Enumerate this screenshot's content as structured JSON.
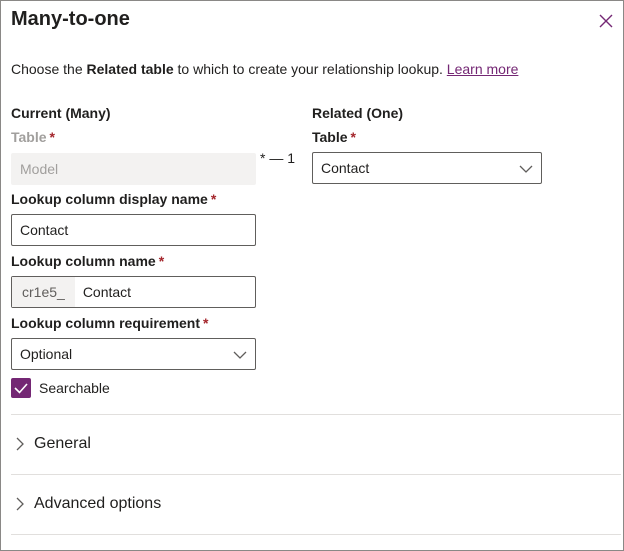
{
  "panel": {
    "title": "Many-to-one",
    "close_icon": "close-icon",
    "intro_prefix": "Choose the ",
    "intro_bold": "Related table",
    "intro_suffix": " to which to create your relationship lookup. ",
    "learn_more": "Learn more"
  },
  "current": {
    "heading": "Current (Many)",
    "table_label": "Table",
    "table_value": "Model",
    "lookup_display_label": "Lookup column display name",
    "lookup_display_value": "Contact",
    "lookup_name_label": "Lookup column name",
    "lookup_name_prefix": "cr1e5_",
    "lookup_name_value": "Contact",
    "requirement_label": "Lookup column requirement",
    "requirement_value": "Optional",
    "searchable_label": "Searchable",
    "searchable_checked": true
  },
  "cardinality": {
    "many": "*",
    "dash": "—",
    "one": "1"
  },
  "related": {
    "heading": "Related (One)",
    "table_label": "Table",
    "table_value": "Contact"
  },
  "required_marker": "*",
  "sections": [
    {
      "label": "General"
    },
    {
      "label": "Advanced options"
    }
  ],
  "colors": {
    "accent": "#742774",
    "required": "#a4262c"
  }
}
